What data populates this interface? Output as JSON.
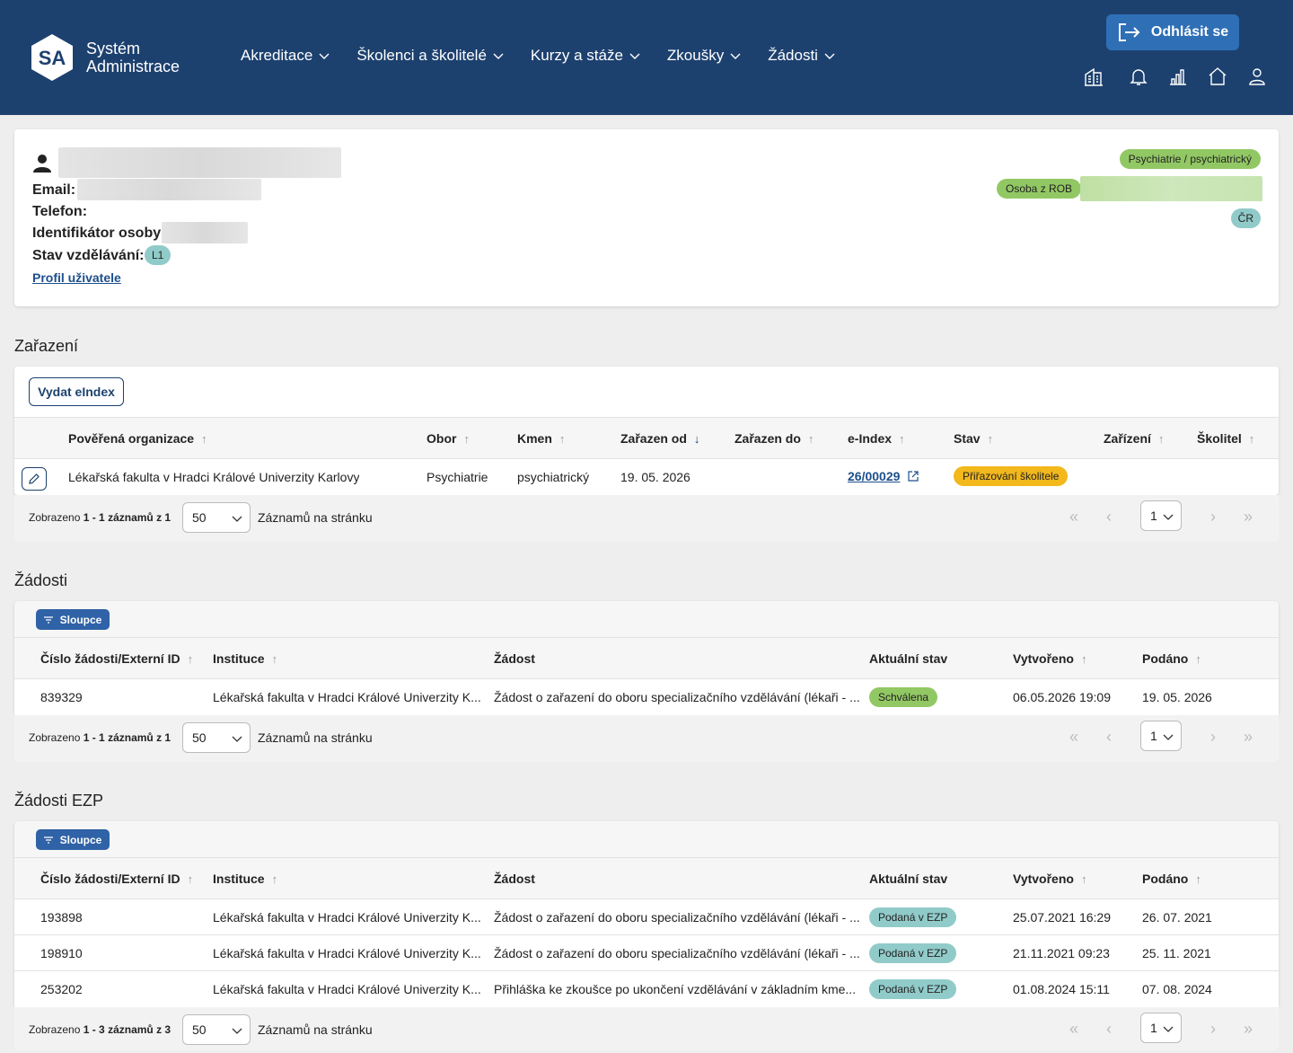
{
  "header": {
    "logo_initials": "SA",
    "logo_line1": "Systém",
    "logo_line2": "Administrace",
    "nav": [
      "Akreditace",
      "Školenci a školitelé",
      "Kurzy a stáže",
      "Zkoušky",
      "Žádosti"
    ],
    "logout_label": "Odhlásit se",
    "icons": [
      "building-icon",
      "bell-icon",
      "bar-chart-icon",
      "home-icon",
      "user-icon"
    ]
  },
  "profile": {
    "email_label": "Email:",
    "phone_label": "Telefon:",
    "id_label": "Identifikátor osoby:",
    "edu_label": "Stav vzdělávání:",
    "edu_badge": "L1",
    "profile_link": "Profil uživatele",
    "badge_specialization": "Psychiatrie / psychiatrický",
    "badge_rob": "Osoba z ROB",
    "badge_country": "ČR"
  },
  "zarazeni": {
    "title": "Zařazení",
    "issue_button": "Vydat eIndex",
    "columns": [
      "Pověřená organizace",
      "Obor",
      "Kmen",
      "Zařazen od",
      "Zařazen do",
      "e-Index",
      "Stav",
      "Zařízení",
      "Školitel"
    ],
    "rows": [
      {
        "org": "Lékařská fakulta v Hradci Králové Univerzity Karlovy",
        "obor": "Psychiatrie",
        "kmen": "psychiatrický",
        "from": "19. 05. 2026",
        "to": "",
        "eindex": "26/00029",
        "stav": "Přiřazování školitele",
        "zarizeni": "",
        "skolitel": ""
      }
    ],
    "footer": {
      "shown_prefix": "Zobrazeno",
      "shown_range": "1 - 1 záznamů z 1",
      "per_page": "50",
      "per_page_label": "Záznamů na stránku",
      "page": "1"
    }
  },
  "zadosti": {
    "title": "Žádosti",
    "columns_button": "Sloupce",
    "columns": [
      "Číslo žádosti/Externí ID",
      "Instituce",
      "Žádost",
      "Aktuální stav",
      "Vytvořeno",
      "Podáno"
    ],
    "rows": [
      {
        "id": "839329",
        "inst": "Lékařská fakulta v Hradci Králové Univerzity K...",
        "zadost": "Žádost o zařazení do oboru specializačního vzdělávání (lékaři - ...",
        "stav": "Schválena",
        "created": "06.05.2026 19:09",
        "submitted": "19. 05. 2026"
      }
    ],
    "footer": {
      "shown_prefix": "Zobrazeno",
      "shown_range": "1 - 1 záznamů z 1",
      "per_page": "50",
      "per_page_label": "Záznamů na stránku",
      "page": "1"
    }
  },
  "zadosti_ezp": {
    "title": "Žádosti EZP",
    "columns_button": "Sloupce",
    "columns": [
      "Číslo žádosti/Externí ID",
      "Instituce",
      "Žádost",
      "Aktuální stav",
      "Vytvořeno",
      "Podáno"
    ],
    "rows": [
      {
        "id": "193898",
        "inst": "Lékařská fakulta v Hradci Králové Univerzity K...",
        "zadost": "Žádost o zařazení do oboru specializačního vzdělávání (lékaři - ...",
        "stav": "Podaná v EZP",
        "created": "25.07.2021 16:29",
        "submitted": "26. 07. 2021"
      },
      {
        "id": "198910",
        "inst": "Lékařská fakulta v Hradci Králové Univerzity K...",
        "zadost": "Žádost o zařazení do oboru specializačního vzdělávání (lékaři - ...",
        "stav": "Podaná v EZP",
        "created": "21.11.2021 09:23",
        "submitted": "25. 11. 2021"
      },
      {
        "id": "253202",
        "inst": "Lékařská fakulta v Hradci Králové Univerzity K...",
        "zadost": "Přihláška ke zkoušce po ukončení vzdělávání v základním kme...",
        "stav": "Podaná v EZP",
        "created": "01.08.2024 15:11",
        "submitted": "07. 08. 2024"
      }
    ],
    "footer": {
      "shown_prefix": "Zobrazeno",
      "shown_range": "1 - 3 záznamů z 3",
      "per_page": "50",
      "per_page_label": "Záznamů na stránku",
      "page": "1"
    }
  },
  "colors": {
    "header_bg": "#1d416f",
    "accent": "#2f6fb6",
    "badge_green": "#92c864",
    "badge_teal": "#90cbc9",
    "badge_orange": "#f2b81c"
  }
}
